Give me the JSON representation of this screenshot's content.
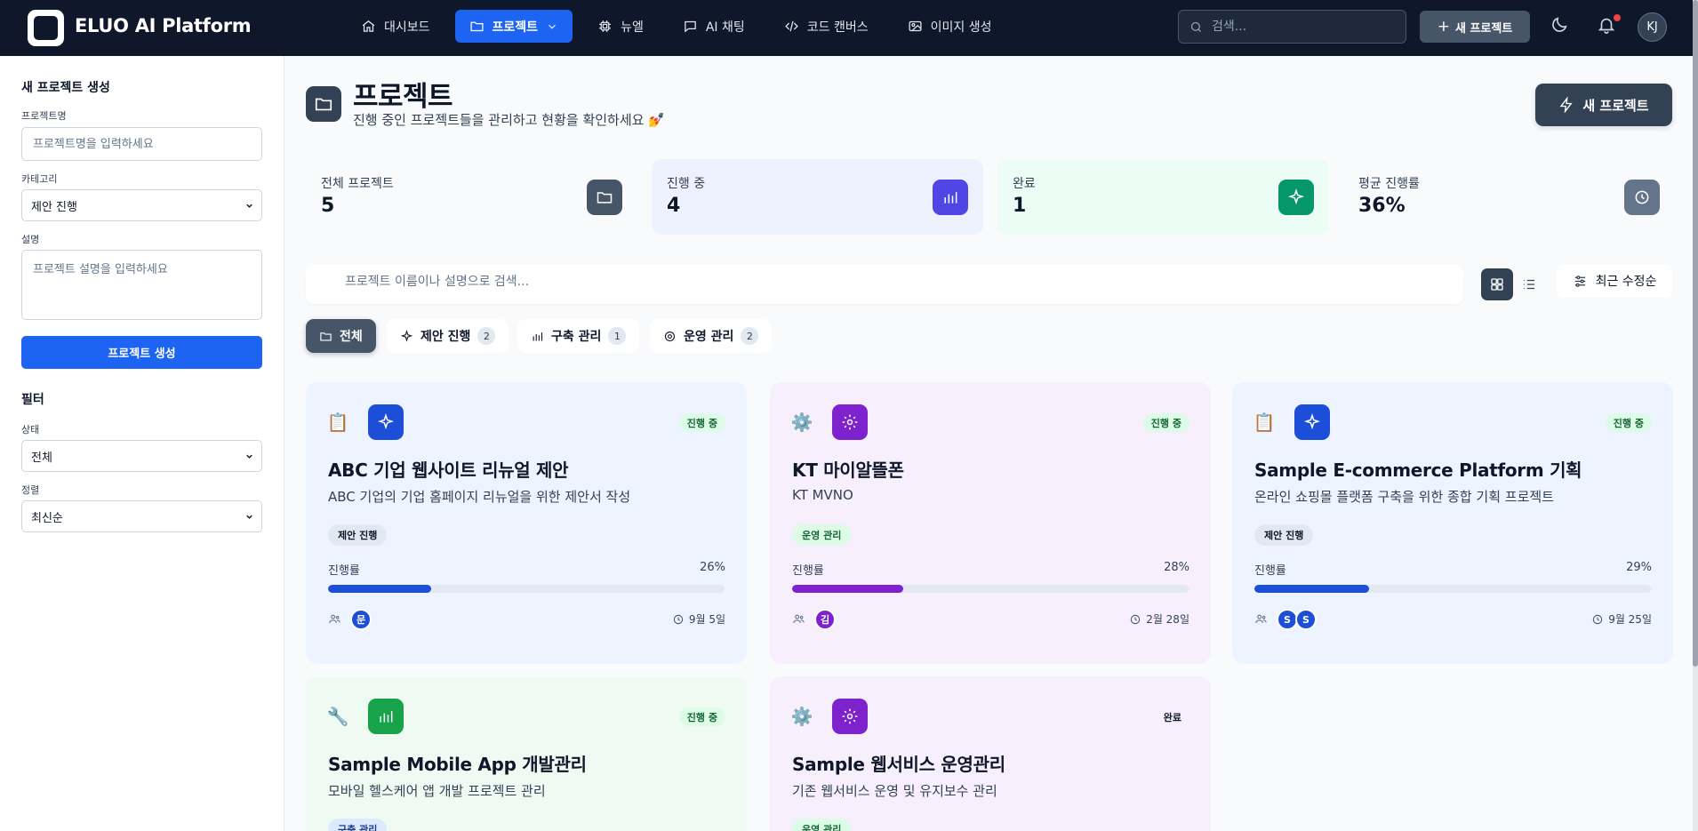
{
  "header": {
    "brand": "ELUO AI Platform",
    "nav": [
      {
        "label": "대시보드",
        "icon": "home-icon"
      },
      {
        "label": "프로젝트",
        "icon": "folder-icon",
        "active": true
      },
      {
        "label": "뉴엘",
        "icon": "cpu-icon"
      },
      {
        "label": "AI 채팅",
        "icon": "chat-icon"
      },
      {
        "label": "코드 캔버스",
        "icon": "code-icon"
      },
      {
        "label": "이미지 생성",
        "icon": "image-icon"
      }
    ],
    "search_placeholder": "검색...",
    "new_project": "새 프로젝트",
    "avatar": "KJ"
  },
  "sidebar": {
    "create_title": "새 프로젝트 생성",
    "name_label": "프로젝트명",
    "name_placeholder": "프로젝트명을 입력하세요",
    "category_label": "카테고리",
    "category_value": "제안 진행",
    "desc_label": "설명",
    "desc_placeholder": "프로젝트 설명을 입력하세요",
    "create_button": "프로젝트 생성",
    "filter_title": "필터",
    "status_label": "상태",
    "status_value": "전체",
    "sort_label": "정렬",
    "sort_value": "최신순"
  },
  "main": {
    "title": "프로젝트",
    "subtitle": "진행 중인 프로젝트들을 관리하고 현황을 확인하세요 💅",
    "new_button": "새 프로젝트",
    "stats": [
      {
        "label": "전체 프로젝트",
        "value": "5",
        "icon": "folder-icon",
        "color": "#475569",
        "bg": "transparent"
      },
      {
        "label": "진행 중",
        "value": "4",
        "icon": "bar-chart-icon",
        "color": "#4f46e5",
        "bg": "#eef2ff"
      },
      {
        "label": "완료",
        "value": "1",
        "icon": "sparkles-icon",
        "color": "#059669",
        "bg": "#ecfdf5"
      },
      {
        "label": "평균 진행률",
        "value": "36%",
        "icon": "clock-icon",
        "color": "#64748b",
        "bg": "transparent"
      }
    ],
    "search_placeholder": "프로젝트 이름이나 설명으로 검색...",
    "sort_label": "최근 수정순",
    "tabs": [
      {
        "label": "전체",
        "count": "",
        "icon": "folder-icon",
        "active": true
      },
      {
        "label": "제안 진행",
        "count": "2",
        "icon": "sparkles-icon"
      },
      {
        "label": "구축 관리",
        "count": "1",
        "icon": "bar-chart-icon"
      },
      {
        "label": "운영 관리",
        "count": "2",
        "icon": "gear-icon"
      }
    ],
    "cards": [
      {
        "emoji": "📋",
        "icon": "sparkles-icon",
        "icon_color": "#1d4ed8",
        "bg": "#eef4ff",
        "status": "진행 중",
        "status_style": "green",
        "title": "ABC 기업 웹사이트 리뉴얼 제안",
        "desc": "ABC 기업의 기업 홈페이지 리뉴얼을 위한 제안서 작성",
        "category": "제안 진행",
        "cat_style": "gray",
        "progress_label": "진행률",
        "progress": 26,
        "progress_text": "26%",
        "bar_color": "#1d4ed8",
        "members": [
          "문"
        ],
        "member_color": "#1d4ed8",
        "date": "9월 5일"
      },
      {
        "emoji": "⚙️",
        "icon": "gear-icon",
        "icon_color": "#7e22ce",
        "bg": "#f7f0fc",
        "status": "진행 중",
        "status_style": "green",
        "title": "KT 마이알뜰폰",
        "desc": "KT MVNO",
        "category": "운영 관리",
        "cat_style": "green",
        "progress_label": "진행률",
        "progress": 28,
        "progress_text": "28%",
        "bar_color": "#7e22ce",
        "members": [
          "김"
        ],
        "member_color": "#7e22ce",
        "date": "2월 28일"
      },
      {
        "emoji": "📋",
        "icon": "sparkles-icon",
        "icon_color": "#1d4ed8",
        "bg": "#eef4ff",
        "status": "진행 중",
        "status_style": "green",
        "title": "Sample E-commerce Platform 기획",
        "desc": "온라인 쇼핑몰 플랫폼 구축을 위한 종합 기획 프로젝트",
        "category": "제안 진행",
        "cat_style": "gray",
        "progress_label": "진행률",
        "progress": 29,
        "progress_text": "29%",
        "bar_color": "#1d4ed8",
        "members": [
          "S",
          "S"
        ],
        "member_color": "#1d4ed8",
        "date": "9월 25일"
      },
      {
        "emoji": "🔧",
        "icon": "bar-chart-icon",
        "icon_color": "#16a34a",
        "bg": "#effbf2",
        "status": "진행 중",
        "status_style": "green",
        "title": "Sample Mobile App 개발관리",
        "desc": "모바일 헬스케어 앱 개발 프로젝트 관리",
        "category": "구축 관리",
        "cat_style": "blue",
        "progress_label": "",
        "progress": 0,
        "progress_text": "",
        "bar_color": "#16a34a",
        "members": [],
        "member_color": "#16a34a",
        "date": ""
      },
      {
        "emoji": "⚙️",
        "icon": "gear-icon",
        "icon_color": "#7e22ce",
        "bg": "#f7f0fc",
        "status": "완료",
        "status_style": "plain",
        "title": "Sample 웹서비스 운영관리",
        "desc": "기존 웹서비스 운영 및 유지보수 관리",
        "category": "운영 관리",
        "cat_style": "green",
        "progress_label": "",
        "progress": 0,
        "progress_text": "",
        "bar_color": "#7e22ce",
        "members": [],
        "member_color": "#7e22ce",
        "date": ""
      }
    ]
  }
}
